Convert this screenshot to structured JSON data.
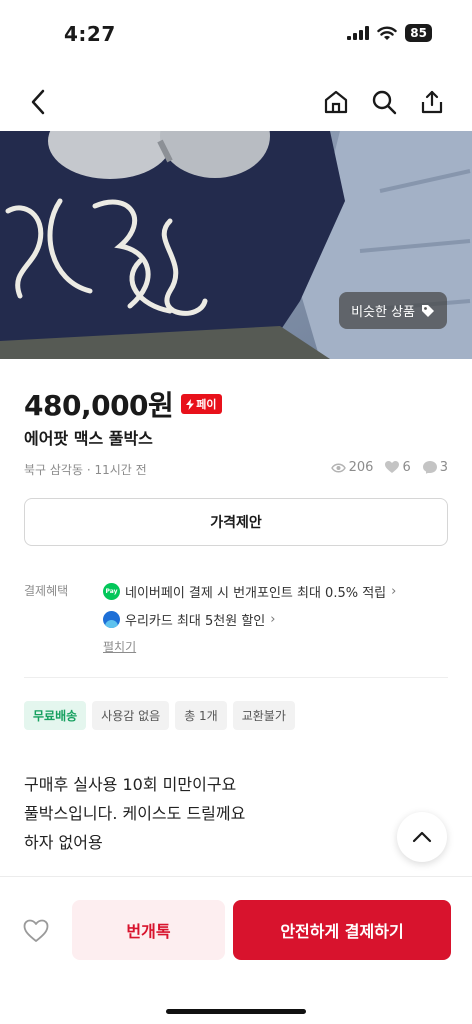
{
  "status_bar": {
    "time": "4:27",
    "battery": "85"
  },
  "nav": {
    "back_icon": "chevron-left-icon",
    "home_icon": "home-icon",
    "search_icon": "search-icon",
    "share_icon": "share-icon"
  },
  "photo": {
    "similar_label": "비슷한 상품"
  },
  "product": {
    "price": "480,000원",
    "pay_badge": "페이",
    "title": "에어팟 맥스 풀박스",
    "location_time": "북구 삼각동 · 11시간 전",
    "views": "206",
    "likes": "6",
    "chats": "3"
  },
  "offer_button": "가격제안",
  "benefits": {
    "label": "결제혜택",
    "naver_pay": "네이버페이 결제 시 번개포인트 최대 0.5% 적립",
    "woori_card": "우리카드 최대 5천원 할인",
    "expand": "펼치기"
  },
  "tags": [
    "무료배송",
    "사용감 없음",
    "총 1개",
    "교환불가"
  ],
  "description": [
    "구매후 실사용 10회 미만이구요",
    "풀박스입니다. 케이스도 드릴께요",
    "하자 없어용"
  ],
  "bottom": {
    "chat_label": "번개톡",
    "pay_label": "안전하게 결제하기"
  },
  "colors": {
    "brand_red": "#d8132d",
    "free_shipping_green": "#16a05f"
  }
}
